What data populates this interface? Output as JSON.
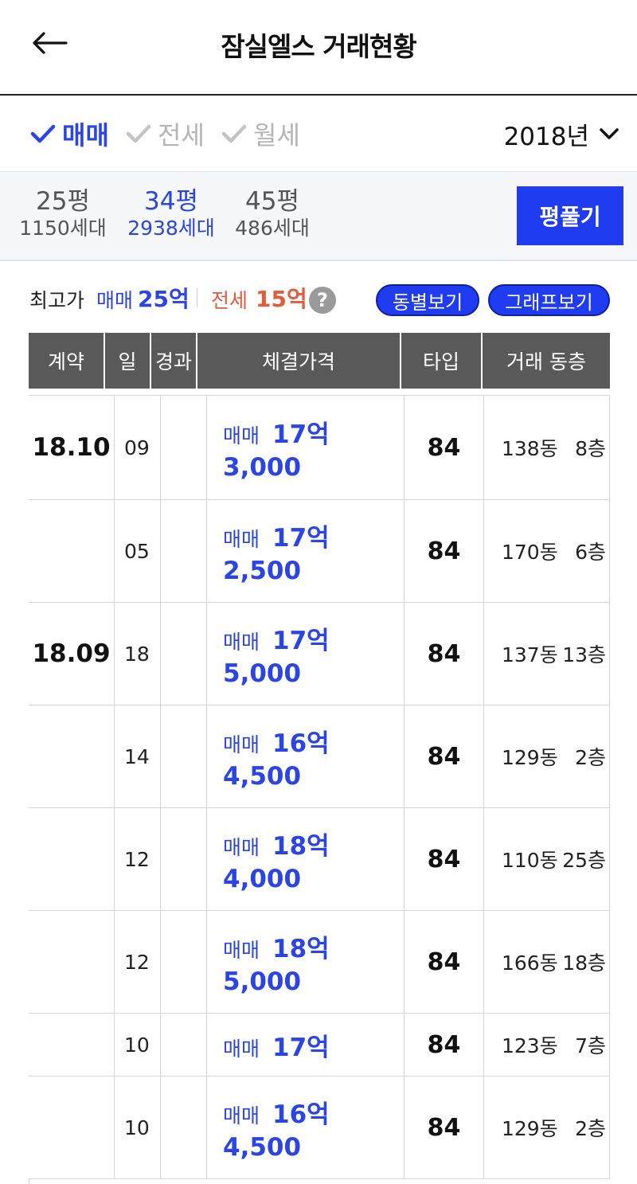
{
  "header": {
    "title": "잠실엘스 거래현황"
  },
  "deal_types": [
    {
      "label": "매매",
      "active": true
    },
    {
      "label": "전세",
      "active": false
    },
    {
      "label": "월세",
      "active": false
    }
  ],
  "year_select": {
    "value": "2018년"
  },
  "sizes": [
    {
      "size": "25평",
      "households": "1150세대",
      "selected": false
    },
    {
      "size": "34평",
      "households": "2938세대",
      "selected": true
    },
    {
      "size": "45평",
      "households": "486세대",
      "selected": false
    }
  ],
  "pyeong_button": "평풀기",
  "max_price": {
    "label": "최고가",
    "sale_label": "매매",
    "sale_value": "25억",
    "jeonse_label": "전세",
    "jeonse_value": "15억",
    "help": "?"
  },
  "pills": {
    "dong": "동별보기",
    "graph": "그래프보기"
  },
  "table": {
    "headers": [
      "계약",
      "일",
      "경과",
      "체결가격",
      "타입",
      "거래 동층"
    ],
    "months": [
      "18.10",
      "18.09"
    ],
    "rows": [
      {
        "day": "09",
        "kind": "매매",
        "eok": "17억",
        "rest": "3,000",
        "type": "84",
        "dong": "138동",
        "floor": "8층"
      },
      {
        "day": "05",
        "kind": "매매",
        "eok": "17억",
        "rest": "2,500",
        "type": "84",
        "dong": "170동",
        "floor": "6층"
      },
      {
        "day": "18",
        "kind": "매매",
        "eok": "17억",
        "rest": "5,000",
        "type": "84",
        "dong": "137동",
        "floor": "13층"
      },
      {
        "day": "14",
        "kind": "매매",
        "eok": "16억",
        "rest": "4,500",
        "type": "84",
        "dong": "129동",
        "floor": "2층"
      },
      {
        "day": "12",
        "kind": "매매",
        "eok": "18억",
        "rest": "4,000",
        "type": "84",
        "dong": "110동",
        "floor": "25층"
      },
      {
        "day": "12",
        "kind": "매매",
        "eok": "18억",
        "rest": "5,000",
        "type": "84",
        "dong": "166동",
        "floor": "18층"
      },
      {
        "day": "10",
        "kind": "매매",
        "eok": "17억",
        "rest": "",
        "type": "84",
        "dong": "123동",
        "floor": "7층"
      },
      {
        "day": "10",
        "kind": "매매",
        "eok": "16억",
        "rest": "4,500",
        "type": "84",
        "dong": "129동",
        "floor": "2층"
      }
    ]
  },
  "colors": {
    "accent": "#2b44e6",
    "jeonse": "#e45b3a",
    "header_bg": "#595959"
  }
}
